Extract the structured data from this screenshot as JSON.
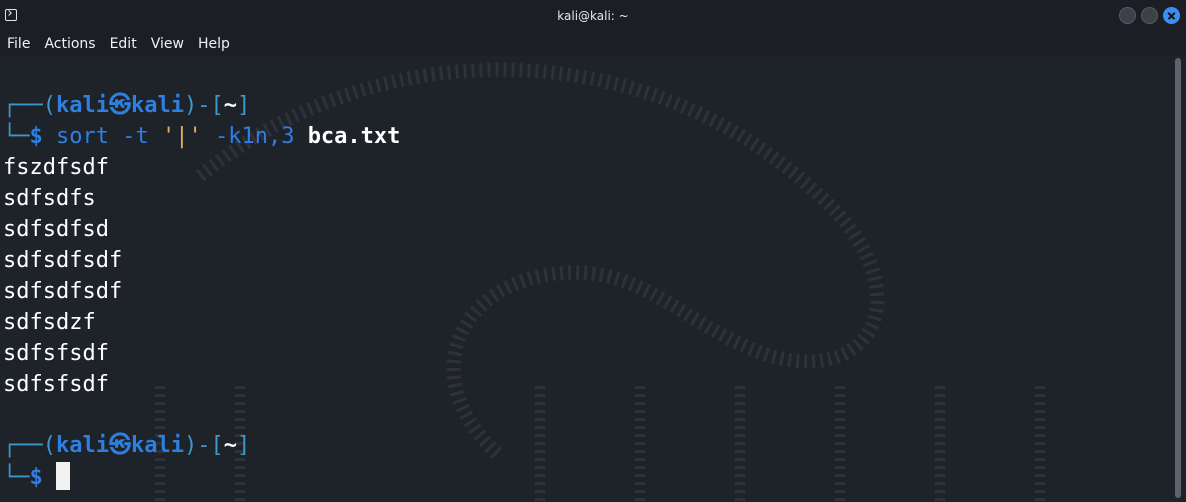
{
  "window": {
    "title": "kali@kali: ~"
  },
  "menu": [
    "File",
    "Actions",
    "Edit",
    "View",
    "Help"
  ],
  "terminal": {
    "prompt1": {
      "top": "┌──(",
      "user": "kali",
      "at": "㉿",
      "host": "kali",
      "mid": ")-[",
      "dir": "~",
      "end": "]",
      "dollar_prefix": "└─",
      "dollar": "$",
      "cmd": "sort",
      "args1": " -t ",
      "str": "'|'",
      "args2": " -k1n,3 ",
      "file": "bca.txt"
    },
    "output": [
      "fszdfsdf",
      "sdfsdfs",
      "sdfsdfsd",
      "sdfsdfsdf",
      "sdfsdfsdf",
      "sdfsdzf",
      "sdfsfsdf",
      "sdfsfsdf"
    ],
    "prompt2": {
      "top": "┌──(",
      "user": "kali",
      "at": "㉿",
      "host": "kali",
      "mid": ")-[",
      "dir": "~",
      "end": "]",
      "dollar_prefix": "└─",
      "dollar": "$"
    }
  },
  "colors": {
    "background": "#1e2229",
    "prompt_frame": "#3d98c9",
    "user_host": "#2f7fe0",
    "string": "#d9b450"
  }
}
